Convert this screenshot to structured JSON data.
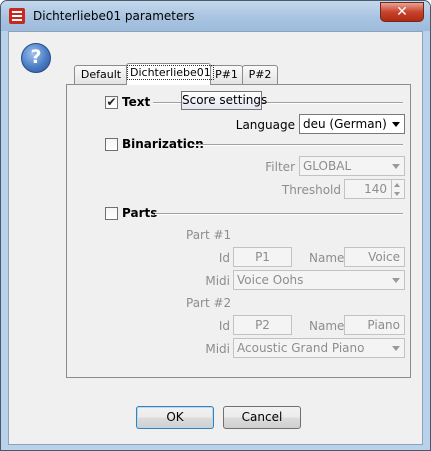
{
  "window": {
    "title": "Dichterliebe01 parameters",
    "close_glyph": "✕",
    "app_icon": "app-logo-icon"
  },
  "help": {
    "glyph": "?",
    "icon": "help-icon"
  },
  "tabs": [
    {
      "label": "Default",
      "active": false
    },
    {
      "label": "Dichterliebe01",
      "active": true
    },
    {
      "label": "P#1",
      "active": false
    },
    {
      "label": "P#2",
      "active": false
    }
  ],
  "tooltip": "Score settings",
  "text_section": {
    "label": "Text",
    "checked": true,
    "checkmark": "✔",
    "language_label": "Language",
    "language_value": "deu (German)"
  },
  "binarization_section": {
    "label": "Binarization",
    "checked": false,
    "filter_label": "Filter",
    "filter_value": "GLOBAL",
    "threshold_label": "Threshold",
    "threshold_value": "140"
  },
  "parts_section": {
    "label": "Parts",
    "checked": false,
    "parts": [
      {
        "heading": "Part #1",
        "id_label": "Id",
        "id_value": "P1",
        "name_label": "Name",
        "name_value": "Voice",
        "midi_label": "Midi",
        "midi_value": "Voice Oohs"
      },
      {
        "heading": "Part #2",
        "id_label": "Id",
        "id_value": "P2",
        "name_label": "Name",
        "name_value": "Piano",
        "midi_label": "Midi",
        "midi_value": "Acoustic Grand Piano"
      }
    ]
  },
  "buttons": {
    "ok": "OK",
    "cancel": "Cancel"
  },
  "colors": {
    "title_bar": "#a9c4e1",
    "close_button": "#c7432c",
    "dialog_bg": "#f0f0f0",
    "disabled_text": "#8d8d8d"
  }
}
